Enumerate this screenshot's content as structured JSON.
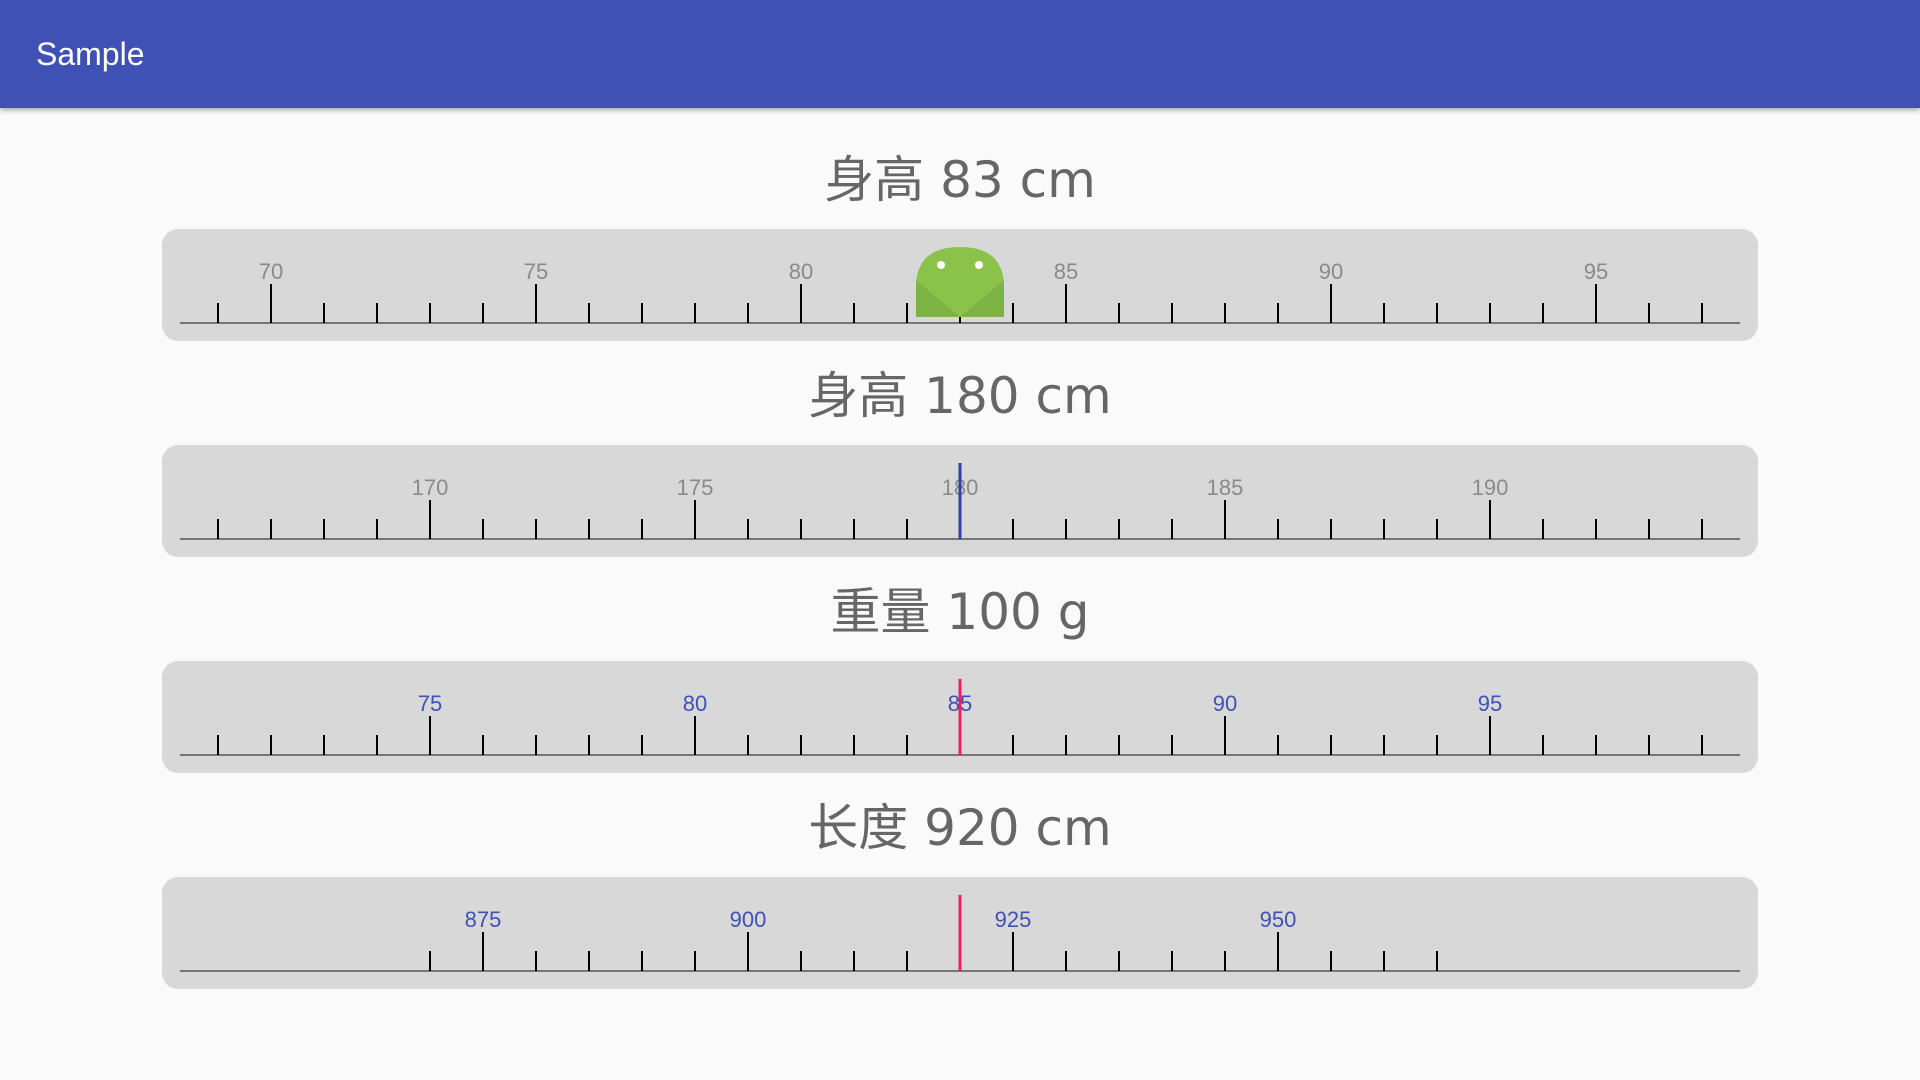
{
  "app": {
    "title": "Sample"
  },
  "rulers": [
    {
      "title": "身高 83 cm",
      "value": 83,
      "minor_step": 1,
      "major_every": 5,
      "visible_range": [
        68,
        97
      ],
      "label_color": "#8a8a8a",
      "tick_color": "#000000",
      "indicator": "android-icon",
      "labels": [
        "70",
        "75",
        "80",
        "85",
        "90",
        "95"
      ]
    },
    {
      "title": "身高 180 cm",
      "value": 180,
      "minor_step": 1,
      "major_every": 5,
      "visible_range": [
        165,
        194
      ],
      "label_color": "#8a8a8a",
      "tick_color": "#000000",
      "indicator": "line",
      "indicator_color": "#303f9f",
      "labels": [
        "170",
        "175",
        "180",
        "185",
        "190"
      ]
    },
    {
      "title": "重量 100 g",
      "value": 85,
      "minor_step": 1,
      "major_every": 5,
      "visible_range": [
        70,
        99
      ],
      "label_color": "#3f51b5",
      "tick_color": "#000000",
      "indicator": "line",
      "indicator_color": "#e91e63",
      "labels": [
        "75",
        "80",
        "85",
        "90",
        "95"
      ]
    },
    {
      "title": "长度 920 cm",
      "value": 920,
      "minor_step": 5,
      "major_every": 25,
      "visible_range": [
        870,
        968
      ],
      "label_color": "#3f51b5",
      "tick_color": "#000000",
      "indicator": "line",
      "indicator_color": "#e91e63",
      "labels": [
        "875",
        "900",
        "925",
        "950"
      ]
    }
  ]
}
